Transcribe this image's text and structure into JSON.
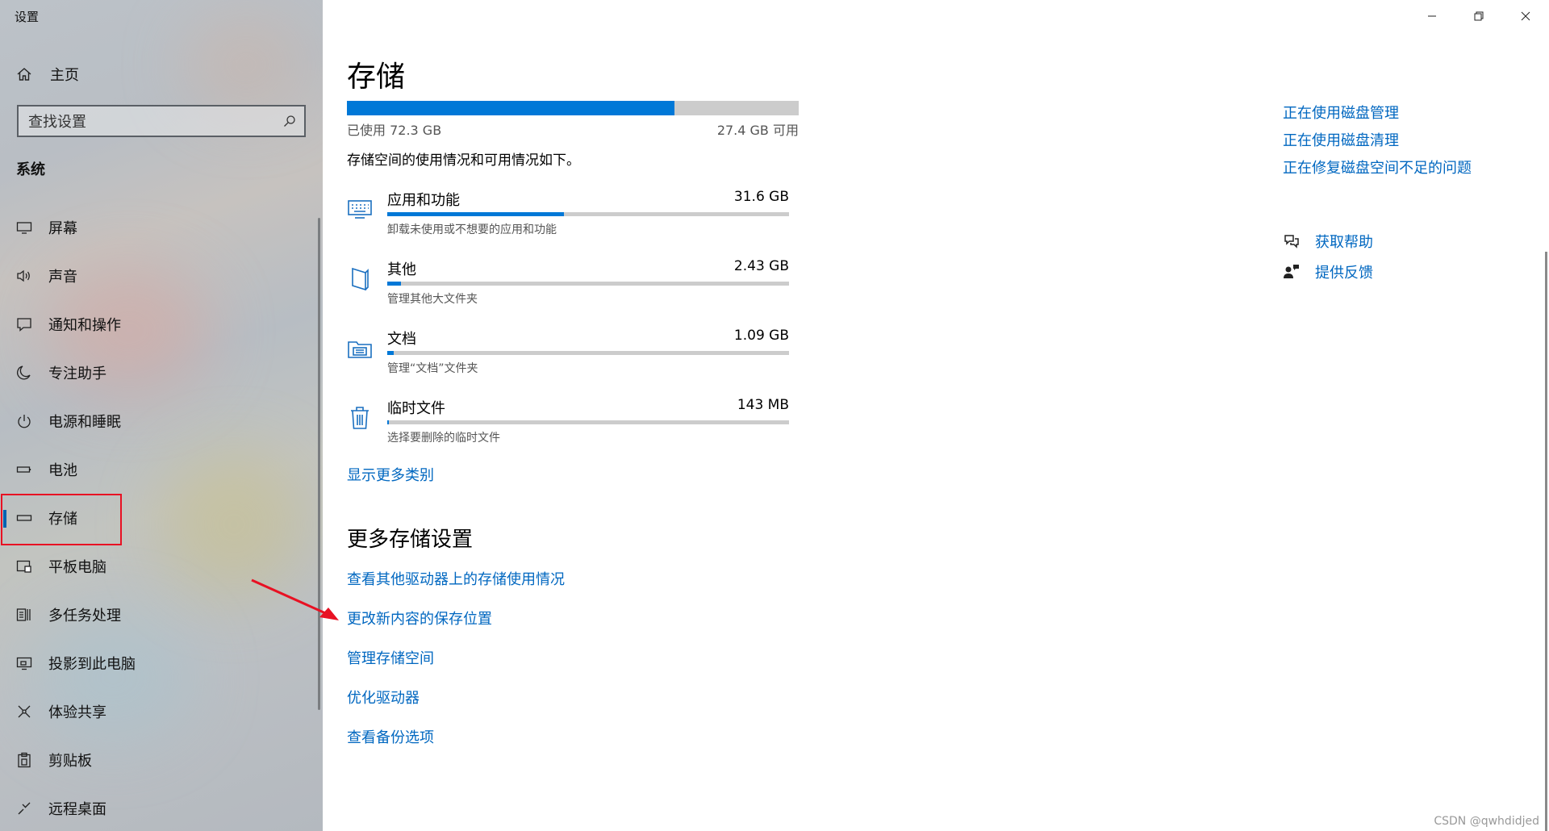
{
  "window": {
    "title": "设置"
  },
  "sidebar": {
    "home_label": "主页",
    "search_placeholder": "查找设置",
    "section_title": "系统",
    "items": [
      {
        "label": "屏幕",
        "icon": "monitor-icon"
      },
      {
        "label": "声音",
        "icon": "speaker-icon"
      },
      {
        "label": "通知和操作",
        "icon": "notification-icon"
      },
      {
        "label": "专注助手",
        "icon": "moon-icon"
      },
      {
        "label": "电源和睡眠",
        "icon": "power-icon"
      },
      {
        "label": "电池",
        "icon": "battery-icon"
      },
      {
        "label": "存储",
        "icon": "storage-drive-icon",
        "active": true
      },
      {
        "label": "平板电脑",
        "icon": "tablet-icon"
      },
      {
        "label": "多任务处理",
        "icon": "multitask-icon"
      },
      {
        "label": "投影到此电脑",
        "icon": "project-icon"
      },
      {
        "label": "体验共享",
        "icon": "share-icon"
      },
      {
        "label": "剪贴板",
        "icon": "clipboard-icon"
      },
      {
        "label": "远程桌面",
        "icon": "remote-desktop-icon"
      }
    ]
  },
  "main": {
    "title": "存储",
    "usage": {
      "used_label": "已使用 72.3 GB",
      "free_label": "27.4 GB 可用",
      "used_fraction": 0.725
    },
    "description": "存储空间的使用情况和可用情况如下。",
    "categories": [
      {
        "name": "应用和功能",
        "size": "31.6 GB",
        "sub": "卸载未使用或不想要的应用和功能",
        "fraction": 0.44,
        "icon": "apps-keyboard-icon"
      },
      {
        "name": "其他",
        "size": "2.43 GB",
        "sub": "管理其他大文件夹",
        "fraction": 0.034,
        "icon": "other-file-icon"
      },
      {
        "name": "文档",
        "size": "1.09 GB",
        "sub": "管理“文档”文件夹",
        "fraction": 0.017,
        "icon": "documents-folder-icon"
      },
      {
        "name": "临时文件",
        "size": "143 MB",
        "sub": "选择要删除的临时文件",
        "fraction": 0.004,
        "icon": "trash-icon"
      }
    ],
    "show_more": "显示更多类别",
    "more_section_title": "更多存储设置",
    "more_links": [
      "查看其他驱动器上的存储使用情况",
      "更改新内容的保存位置",
      "管理存储空间",
      "优化驱动器",
      "查看备份选项"
    ],
    "right_links": [
      "正在使用磁盘管理",
      "正在使用磁盘清理",
      "正在修复磁盘空间不足的问题"
    ],
    "help": {
      "get_help": "获取帮助",
      "feedback": "提供反馈"
    },
    "watermark": "CSDN @qwhdidjed"
  },
  "colors": {
    "accent": "#0078d7",
    "link": "#0067c0",
    "highlight_box": "#e81123"
  }
}
